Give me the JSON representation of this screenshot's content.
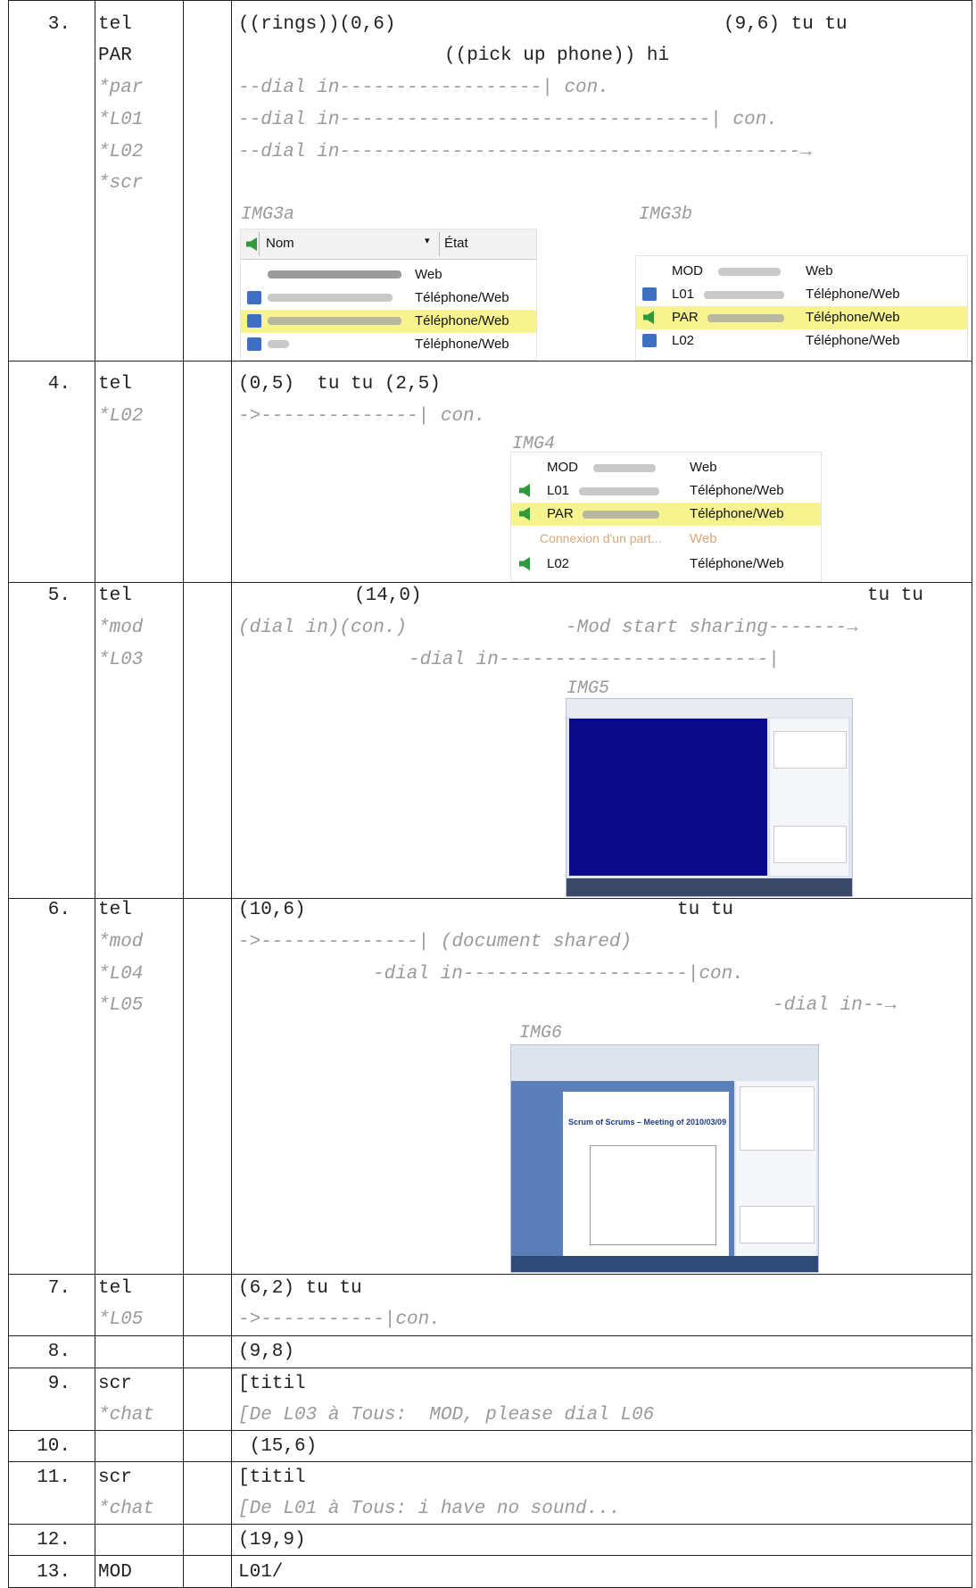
{
  "rows": [
    {
      "num": "3.",
      "tier": "tel",
      "lines": [
        "((rings))(0,6)",
        "(9,6) tu tu"
      ]
    },
    {
      "tier": "PAR",
      "lines": [
        "((pick up phone)) hi"
      ]
    },
    {
      "tier": "*par",
      "lines": [
        "--dial in------------------| con."
      ]
    },
    {
      "tier": "*L01",
      "lines": [
        "--dial in---------------------------------| con."
      ]
    },
    {
      "tier": "*L02",
      "lines": [
        "--dial in-----------------------------------------→"
      ]
    },
    {
      "tier": "*scr",
      "lines": []
    },
    {
      "num": "4.",
      "tier": "tel",
      "lines": [
        "(0,5)  tu tu (2,5)"
      ]
    },
    {
      "tier": "*L02",
      "lines": [
        "->--------------| con."
      ]
    },
    {
      "num": "5.",
      "tier": "tel",
      "lines": [
        "(14,0)",
        "tu tu"
      ]
    },
    {
      "tier": "*mod",
      "lines": [
        "(dial in)(con.)",
        "-Mod start sharing-------→"
      ]
    },
    {
      "tier": "*L03",
      "lines": [
        "-dial in------------------------|"
      ]
    },
    {
      "num": "6.",
      "tier": "tel",
      "lines": [
        "(10,6)",
        "tu tu"
      ]
    },
    {
      "tier": "*mod",
      "lines": [
        "->--------------| (document shared)"
      ]
    },
    {
      "tier": "*L04",
      "lines": [
        "-dial in--------------------|con."
      ]
    },
    {
      "tier": "*L05",
      "lines": [
        "-dial in--→"
      ]
    },
    {
      "num": "7.",
      "tier": "tel",
      "lines": [
        "(6,2) tu tu"
      ]
    },
    {
      "tier": "*L05",
      "lines": [
        "->-----------|con."
      ]
    },
    {
      "num": "8.",
      "tier": "",
      "lines": [
        "(9,8)"
      ]
    },
    {
      "num": "9.",
      "tier": "scr",
      "lines": [
        "[titil"
      ]
    },
    {
      "tier": "*chat",
      "lines": [
        "[De L03 à Tous:  MOD, please dial L06"
      ]
    },
    {
      "num": "10.",
      "tier": "",
      "lines": [
        " (15,6)"
      ]
    },
    {
      "num": "11.",
      "tier": "scr",
      "lines": [
        "[titil"
      ]
    },
    {
      "tier": "*chat",
      "lines": [
        "[De L01 à Tous: i have no sound..."
      ]
    },
    {
      "num": "12.",
      "tier": "",
      "lines": [
        "(19,9)"
      ]
    },
    {
      "num": "13.",
      "tier": "MOD",
      "lines": [
        "L01/"
      ]
    }
  ],
  "captions": {
    "img3a": "IMG3a",
    "img3b": "IMG3b",
    "img4": "IMG4",
    "img5": "IMG5",
    "img6": "IMG6"
  },
  "img3a": {
    "col_name": "Nom",
    "col_state": "État",
    "states": [
      "Web",
      "Téléphone/Web",
      "Téléphone/Web",
      "Téléphone/Web"
    ]
  },
  "img3b": {
    "names": [
      "MOD",
      "L01",
      "PAR",
      "L02"
    ],
    "states": [
      "Web",
      "Téléphone/Web",
      "Téléphone/Web",
      "Téléphone/Web"
    ]
  },
  "img4": {
    "names": [
      "MOD",
      "L01",
      "PAR",
      "Connexion d'un part...",
      "L02"
    ],
    "states": [
      "Web",
      "Téléphone/Web",
      "Téléphone/Web",
      "Web",
      "Téléphone/Web"
    ]
  },
  "img6": {
    "doc_title": "Scrum of Scrums – Meeting of 2010/03/09"
  },
  "colors": {
    "highlight": "#f7f38f",
    "shared_screen": "#0a0a8a",
    "annotation": "#9a9a9a",
    "phone_icon": "#3d6fc2",
    "speaker_icon": "#2f9a3c"
  }
}
